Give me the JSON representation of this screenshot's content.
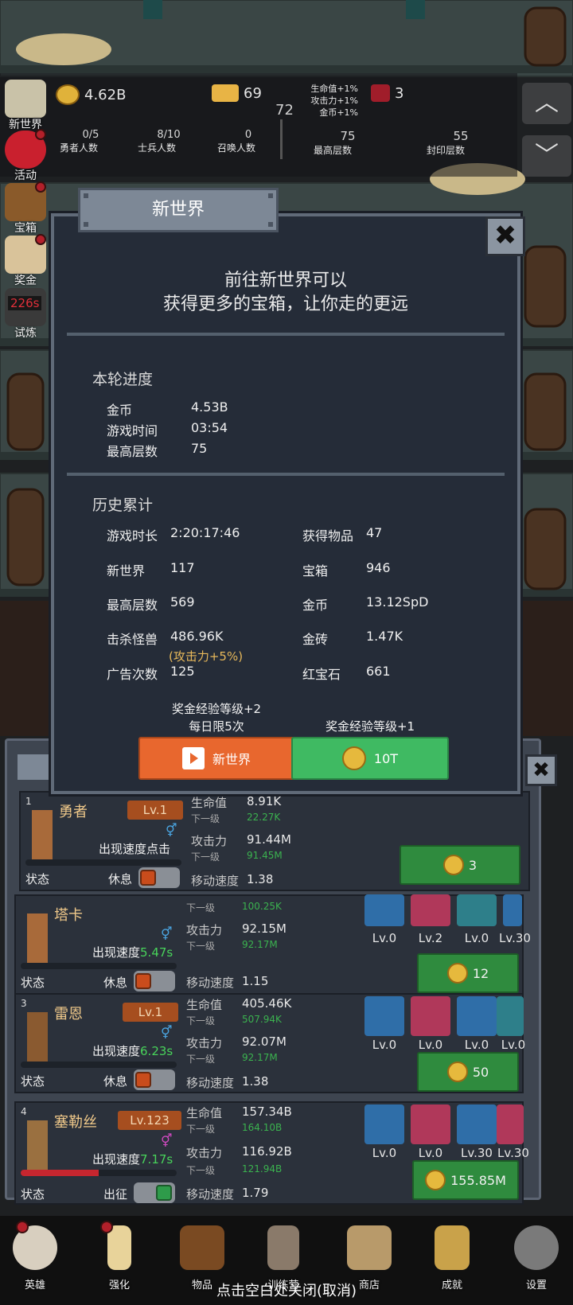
{
  "resources": {
    "gold": "4.62B",
    "gold_bar": "69",
    "ruby": "3",
    "floor_center": "72",
    "bonus_lines": [
      "生命值+1%",
      "攻击力+1%",
      "金币+1%"
    ]
  },
  "counters": [
    {
      "value": "0/5",
      "label": "勇者人数"
    },
    {
      "value": "8/10",
      "label": "士兵人数"
    },
    {
      "value": "0",
      "label": "召唤人数"
    },
    {
      "value": "75",
      "label": "最高层数"
    },
    {
      "value": "55",
      "label": "封印层数"
    }
  ],
  "side_menu": [
    {
      "label": "新世界",
      "icon": "scroll-map-icon",
      "dot": false
    },
    {
      "label": "活动",
      "icon": "heart-icon",
      "dot": true
    },
    {
      "label": "宝箱",
      "icon": "treasure-chest-icon",
      "dot": true
    },
    {
      "label": "奖金",
      "icon": "envelope-icon",
      "dot": true
    },
    {
      "label": "试炼",
      "icon": "trial-icon",
      "dot": false,
      "timer": "226s"
    }
  ],
  "modal": {
    "title": "新世界",
    "intro_line1": "前往新世界可以",
    "intro_line2": "获得更多的宝箱，让你走的更远",
    "round_title": "本轮进度",
    "round": [
      {
        "k": "金币",
        "v": "4.53B"
      },
      {
        "k": "游戏时间",
        "v": "03:54"
      },
      {
        "k": "最高层数",
        "v": "75"
      }
    ],
    "history_title": "历史累计",
    "history_left": [
      {
        "k": "游戏时长",
        "v": "2:20:17:46"
      },
      {
        "k": "新世界",
        "v": "117"
      },
      {
        "k": "最高层数",
        "v": "569"
      },
      {
        "k": "击杀怪兽",
        "v": "486.96K"
      },
      {
        "k": "广告次数",
        "v": "125"
      }
    ],
    "history_right": [
      {
        "k": "获得物品",
        "v": "47"
      },
      {
        "k": "宝箱",
        "v": "946"
      },
      {
        "k": "金币",
        "v": "13.12SpD"
      },
      {
        "k": "金砖",
        "v": "1.47K"
      },
      {
        "k": "红宝石",
        "v": "661"
      }
    ],
    "kill_note": "(攻击力+5%)",
    "left_caption_1": "奖金经验等级+2",
    "left_caption_2": "每日限5次",
    "right_caption": "奖金经验等级+1",
    "left_button": "新世界",
    "right_button": "10T",
    "close": "✖"
  },
  "heroes": [
    {
      "num": "1",
      "name": "勇者",
      "level": "Lv.1",
      "gender": "⚥",
      "speed_label": "出现速度点击",
      "speed_value": "",
      "hp": "8.91K",
      "hp_next": "22.27K",
      "atk": "91.44M",
      "atk_next": "91.45M",
      "move": "1.38",
      "state": "状态",
      "mode": "休息",
      "cost": "3",
      "on": false,
      "hp_fill": 0
    },
    {
      "num": "2",
      "name": "塔卡",
      "level": "Lv.1",
      "gender": "⚥",
      "speed_label": "出现速度",
      "speed_value": "5.47s",
      "hp": "",
      "hp_next": "100.25K",
      "atk": "92.15M",
      "atk_next": "92.17M",
      "move": "1.15",
      "state": "状态",
      "mode": "休息",
      "cost": "12",
      "on": false,
      "hp_fill": 0,
      "equips": [
        "Lv.0",
        "Lv.2",
        "Lv.0",
        "Lv.30"
      ]
    },
    {
      "num": "3",
      "name": "雷恩",
      "level": "Lv.1",
      "gender": "⚥",
      "speed_label": "出现速度",
      "speed_value": "6.23s",
      "hp": "405.46K",
      "hp_next": "507.94K",
      "atk": "92.07M",
      "atk_next": "92.17M",
      "move": "1.38",
      "state": "状态",
      "mode": "休息",
      "cost": "50",
      "on": false,
      "hp_fill": 0,
      "equips": [
        "Lv.0",
        "Lv.0",
        "Lv.0",
        "Lv.0"
      ]
    },
    {
      "num": "4",
      "name": "塞勒丝",
      "level": "Lv.123",
      "gender": "⚥",
      "speed_label": "出现速度",
      "speed_value": "7.17s",
      "hp": "157.34B",
      "hp_next": "164.10B",
      "atk": "116.92B",
      "atk_next": "121.94B",
      "move": "1.79",
      "state": "状态",
      "mode": "出征",
      "cost": "155.85M",
      "on": true,
      "hp_fill": 0.5,
      "equips": [
        "Lv.0",
        "Lv.0",
        "Lv.30",
        "Lv.30"
      ]
    }
  ],
  "stat_labels": {
    "hp": "生命值",
    "next": "下一级",
    "atk": "攻击力",
    "move": "移动速度"
  },
  "bottom_nav": [
    {
      "label": "英雄",
      "icon": "skull-icon",
      "dot": true
    },
    {
      "label": "强化",
      "icon": "candle-icon",
      "dot": true
    },
    {
      "label": "物品",
      "icon": "book-icon",
      "dot": false
    },
    {
      "label": "训练营",
      "icon": "lantern-icon",
      "dot": false
    },
    {
      "label": "商店",
      "icon": "beer-mug-icon",
      "dot": false
    },
    {
      "label": "成就",
      "icon": "key-icon",
      "dot": false
    },
    {
      "label": "设置",
      "icon": "gear-icon",
      "dot": false
    }
  ],
  "close_hint": "点击空白处关闭(取消)",
  "colors": {
    "accent_orange": "#e8672e",
    "accent_green": "#3fba62",
    "panel_bg": "#252c38",
    "gold_text": "#e7b85a"
  }
}
